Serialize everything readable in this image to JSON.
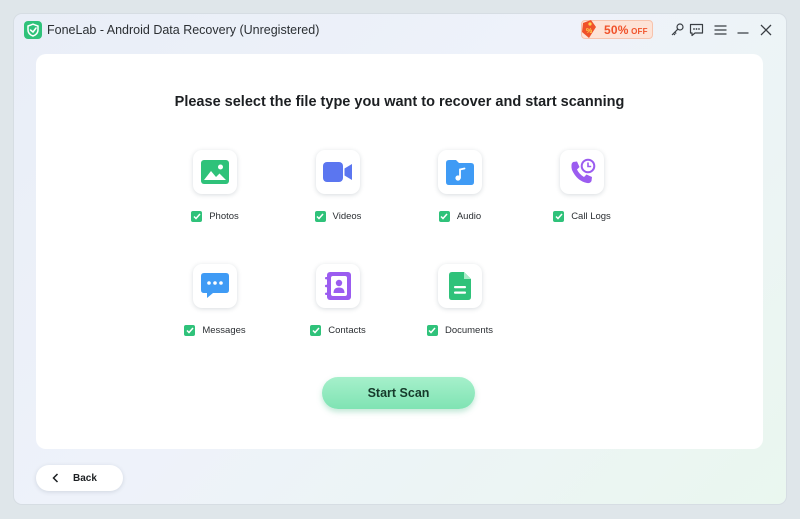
{
  "titlebar": {
    "title": "FoneLab - Android Data Recovery (Unregistered)",
    "promo": {
      "value": "50%",
      "suffix": "OFF"
    },
    "icons": [
      "key-icon",
      "feedback-icon",
      "menu-icon",
      "minimize-icon",
      "close-icon"
    ]
  },
  "main": {
    "heading": "Please select the file type you want to recover and start scanning",
    "file_types": [
      {
        "label": "Photos",
        "icon": "photos-icon",
        "checked": true,
        "color": "#2fc27a"
      },
      {
        "label": "Videos",
        "icon": "videos-icon",
        "checked": true,
        "color": "#5b76f0"
      },
      {
        "label": "Audio",
        "icon": "audio-icon",
        "checked": true,
        "color": "#3f9bf5"
      },
      {
        "label": "Call Logs",
        "icon": "call-logs-icon",
        "checked": true,
        "color": "#9b5cf0"
      },
      {
        "label": "Messages",
        "icon": "messages-icon",
        "checked": true,
        "color": "#3f9bf5"
      },
      {
        "label": "Contacts",
        "icon": "contacts-icon",
        "checked": true,
        "color": "#9b5cf0"
      },
      {
        "label": "Documents",
        "icon": "documents-icon",
        "checked": true,
        "color": "#2fc27a"
      }
    ],
    "scan_button": "Start Scan"
  },
  "footer": {
    "back_button": "Back"
  },
  "colors": {
    "accent": "#2fc27a",
    "promo": "#f0522a"
  }
}
